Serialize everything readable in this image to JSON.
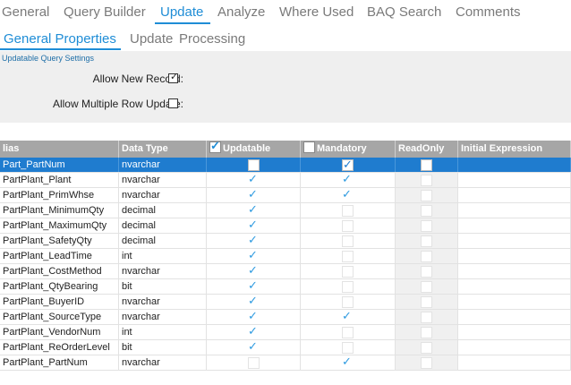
{
  "tabs": [
    {
      "label": "General",
      "active": false
    },
    {
      "label": "Query Builder",
      "active": false
    },
    {
      "label": "Update",
      "active": true
    },
    {
      "label": "Analyze",
      "active": false
    },
    {
      "label": "Where Used",
      "active": false
    },
    {
      "label": "BAQ Search",
      "active": false
    },
    {
      "label": "Comments",
      "active": false
    }
  ],
  "subtabs": [
    {
      "label": "General Properties",
      "active": true
    },
    {
      "label": "Update",
      "active": false
    },
    {
      "label": "Processing",
      "active": false
    }
  ],
  "settings": {
    "title": "Updatable Query Settings",
    "allow_new_record_label": "Allow New Record:",
    "allow_new_record": true,
    "allow_multiple_row_update_label": "Allow Multiple Row Update:",
    "allow_multiple_row_update": false
  },
  "grid": {
    "columns": [
      {
        "label": "lias",
        "checkbox": false
      },
      {
        "label": "Data Type",
        "checkbox": false
      },
      {
        "label": "Updatable",
        "checkbox": true,
        "checked": true
      },
      {
        "label": "Mandatory",
        "checkbox": true,
        "checked": false
      },
      {
        "label": "ReadOnly",
        "checkbox": false
      },
      {
        "label": "Initial Expression",
        "checkbox": false
      }
    ],
    "rows": [
      {
        "alias": "Part_PartNum",
        "data_type": "nvarchar",
        "updatable": false,
        "mandatory": true,
        "readonly": false,
        "selected": true
      },
      {
        "alias": "PartPlant_Plant",
        "data_type": "nvarchar",
        "updatable": true,
        "mandatory": true,
        "readonly": false,
        "selected": false
      },
      {
        "alias": "PartPlant_PrimWhse",
        "data_type": "nvarchar",
        "updatable": true,
        "mandatory": true,
        "readonly": false,
        "selected": false
      },
      {
        "alias": "PartPlant_MinimumQty",
        "data_type": "decimal",
        "updatable": true,
        "mandatory": false,
        "readonly": false,
        "selected": false
      },
      {
        "alias": "PartPlant_MaximumQty",
        "data_type": "decimal",
        "updatable": true,
        "mandatory": false,
        "readonly": false,
        "selected": false
      },
      {
        "alias": "PartPlant_SafetyQty",
        "data_type": "decimal",
        "updatable": true,
        "mandatory": false,
        "readonly": false,
        "selected": false
      },
      {
        "alias": "PartPlant_LeadTime",
        "data_type": "int",
        "updatable": true,
        "mandatory": false,
        "readonly": false,
        "selected": false
      },
      {
        "alias": "PartPlant_CostMethod",
        "data_type": "nvarchar",
        "updatable": true,
        "mandatory": false,
        "readonly": false,
        "selected": false
      },
      {
        "alias": "PartPlant_QtyBearing",
        "data_type": "bit",
        "updatable": true,
        "mandatory": false,
        "readonly": false,
        "selected": false
      },
      {
        "alias": "PartPlant_BuyerID",
        "data_type": "nvarchar",
        "updatable": true,
        "mandatory": false,
        "readonly": false,
        "selected": false
      },
      {
        "alias": "PartPlant_SourceType",
        "data_type": "nvarchar",
        "updatable": true,
        "mandatory": true,
        "readonly": false,
        "selected": false
      },
      {
        "alias": "PartPlant_VendorNum",
        "data_type": "int",
        "updatable": true,
        "mandatory": false,
        "readonly": false,
        "selected": false
      },
      {
        "alias": "PartPlant_ReOrderLevel",
        "data_type": "bit",
        "updatable": true,
        "mandatory": false,
        "readonly": false,
        "selected": false
      },
      {
        "alias": "PartPlant_PartNum",
        "data_type": "nvarchar",
        "updatable": false,
        "mandatory": true,
        "readonly": false,
        "selected": false
      }
    ]
  },
  "icons": {
    "check": "checkmark-icon"
  },
  "colors": {
    "accent": "#1f8dd6",
    "selected_row": "#1f7ccf",
    "header_bg": "#a6a6a6",
    "settings_bg": "#efefef"
  }
}
